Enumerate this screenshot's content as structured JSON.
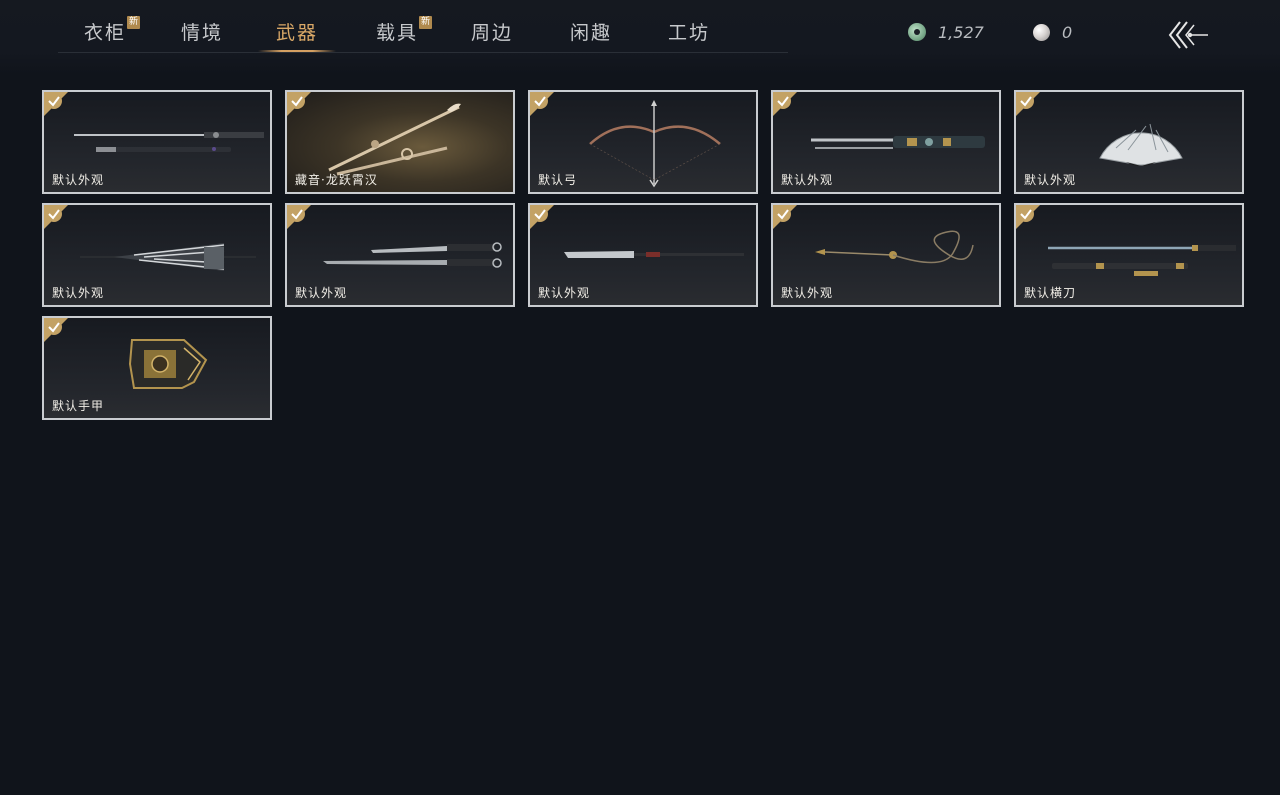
{
  "tabs": [
    {
      "label": "衣柜",
      "badge": "新",
      "active": false
    },
    {
      "label": "情境",
      "badge": "",
      "active": false
    },
    {
      "label": "武器",
      "badge": "",
      "active": true
    },
    {
      "label": "载具",
      "badge": "新",
      "active": false
    },
    {
      "label": "周边",
      "badge": "",
      "active": false
    },
    {
      "label": "闲趣",
      "badge": "",
      "active": false
    },
    {
      "label": "工坊",
      "badge": "",
      "active": false
    }
  ],
  "currency": {
    "jade_amount": "1,527",
    "pearl_amount": "0"
  },
  "items": [
    {
      "label": "默认外观",
      "icon": "straight-sword-icon",
      "owned": true
    },
    {
      "label": "藏音·龙跃霄汉",
      "icon": "ornate-sword-icon",
      "owned": true
    },
    {
      "label": "默认弓",
      "icon": "bow-icon",
      "owned": true
    },
    {
      "label": "默认外观",
      "icon": "dual-blade-icon",
      "owned": true
    },
    {
      "label": "默认外观",
      "icon": "fan-icon",
      "owned": true
    },
    {
      "label": "默认外观",
      "icon": "umbrella-icon",
      "owned": true
    },
    {
      "label": "默认外观",
      "icon": "twin-sabers-icon",
      "owned": true
    },
    {
      "label": "默认外观",
      "icon": "long-blade-icon",
      "owned": true
    },
    {
      "label": "默认外观",
      "icon": "rope-dart-icon",
      "owned": true
    },
    {
      "label": "默认横刀",
      "icon": "hengdao-icon",
      "owned": true
    },
    {
      "label": "默认手甲",
      "icon": "gauntlet-icon",
      "owned": true
    }
  ],
  "colors": {
    "accent": "#d9a867",
    "check": "#c3a265",
    "card_border": "#c9ccd0",
    "background": "#10141b"
  }
}
